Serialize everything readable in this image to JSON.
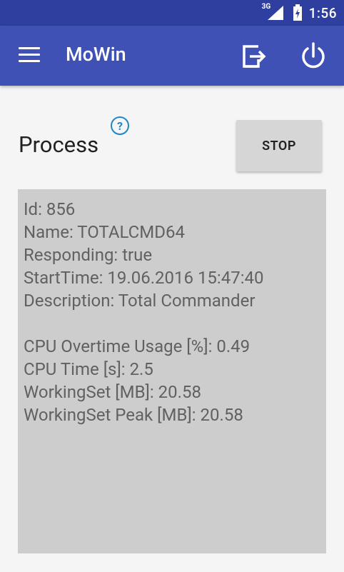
{
  "statusbar": {
    "network": "3G",
    "time": "1:56"
  },
  "appbar": {
    "title": "MoWin",
    "icons": [
      "menu-icon",
      "exit-icon",
      "power-icon"
    ]
  },
  "process": {
    "title": "Process",
    "help_glyph": "?",
    "stop_label": "STOP"
  },
  "info": {
    "group1": [
      "Id: 856",
      "Name: TOTALCMD64",
      "Responding: true",
      "StartTime: 19.06.2016 15:47:40",
      "Description: Total Commander"
    ],
    "group2": [
      "CPU Overtime Usage [%]: 0.49",
      "CPU Time [s]: 2.5",
      "WorkingSet [MB]: 20.58",
      "WorkingSet Peak [MB]: 20.58"
    ]
  },
  "colors": {
    "statusbar": "#2f3f9f",
    "appbar": "#3f51b5",
    "help": "#1e88c7",
    "panel": "#cdcdcd"
  }
}
